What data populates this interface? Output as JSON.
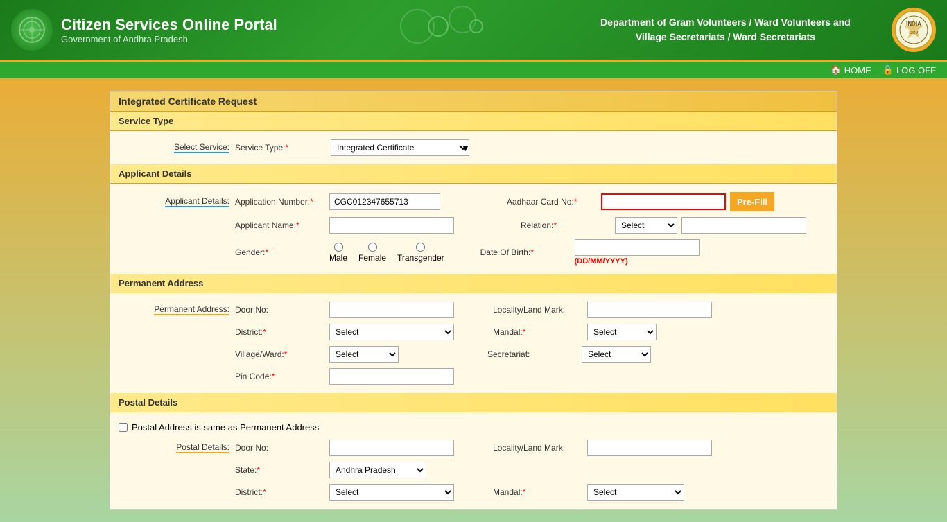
{
  "header": {
    "title": "Citizen Services Online Portal",
    "subtitle": "Government of Andhra Pradesh",
    "dept_line1": "Department of Gram Volunteers / Ward Volunteers and",
    "dept_line2": "Village Secretariats / Ward Secretariats",
    "nav": {
      "home": "HOME",
      "logoff": "LOG OFF"
    }
  },
  "form": {
    "page_title": "Integrated Certificate Request",
    "service_type_section": "Service Type",
    "select_service_label": "Select Service:",
    "service_type_label": "Service Type:",
    "service_type_value": "Integrated Certificate",
    "service_type_options": [
      "Integrated Certificate"
    ],
    "applicant_details_section": "Applicant Details",
    "applicant_details_label": "Applicant Details:",
    "app_number_label": "Application Number:",
    "app_number_value": "CGC012347655713",
    "aadhaar_label": "Aadhaar Card No:",
    "aadhaar_value": "",
    "prefill_btn": "Pre-Fill",
    "applicant_name_label": "Applicant Name:",
    "applicant_name_value": "",
    "relation_label": "Relation:",
    "relation_options": [
      "Select"
    ],
    "gender_label": "Gender:",
    "gender_options": [
      "Male",
      "Female",
      "Transgender"
    ],
    "dob_label": "Date Of Birth:",
    "dob_value": "",
    "dob_hint": "(DD/MM/YYYY)",
    "permanent_address_section": "Permanent Address",
    "permanent_address_label": "Permanent Address:",
    "door_no_label": "Door No:",
    "door_no_value": "",
    "locality_label": "Locality/Land Mark:",
    "locality_value": "",
    "district_label": "District:",
    "district_options": [
      "Select"
    ],
    "mandal_label": "Mandal:",
    "mandal_options": [
      "Select"
    ],
    "village_label": "Village/Ward:",
    "village_options": [
      "Select"
    ],
    "secretariat_label": "Secretariat:",
    "secretariat_options": [
      "Select"
    ],
    "pin_code_label": "Pin Code:",
    "pin_code_value": "",
    "postal_details_section": "Postal Details",
    "postal_same_label": "Postal Address is same as Permanent Address",
    "postal_details_label": "Postal Details:",
    "postal_door_label": "Door No:",
    "postal_door_value": "",
    "postal_locality_label": "Locality/Land Mark:",
    "postal_locality_value": "",
    "state_label": "State:",
    "state_options": [
      "Andhra Pradesh"
    ],
    "state_value": "Andhra Pradesh",
    "postal_district_label": "District:",
    "postal_district_options": [
      "Select"
    ],
    "postal_mandal_label": "Mandal:",
    "postal_mandal_options": [
      "Select"
    ]
  }
}
